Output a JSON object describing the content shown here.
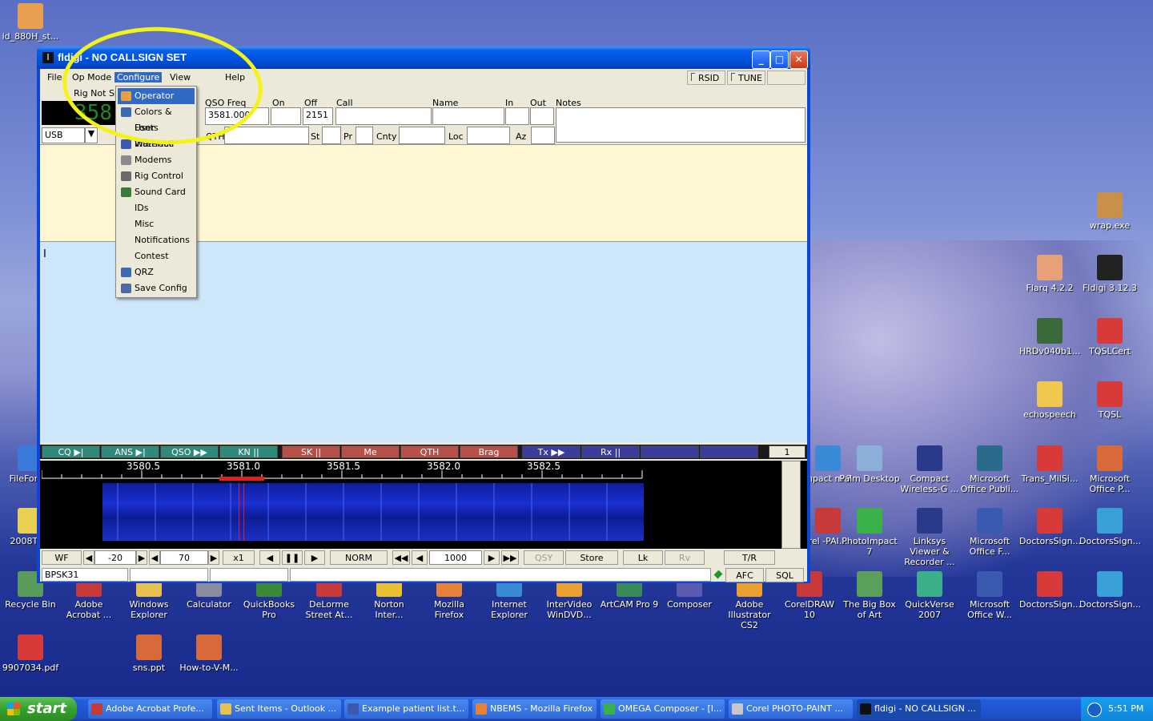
{
  "window": {
    "title": "fldigi - NO CALLSIGN SET"
  },
  "menubar": {
    "items": [
      "File",
      "Op Mode",
      "Configure",
      "View",
      "Help"
    ],
    "rsid": "RSID",
    "tune": "TUNE"
  },
  "rig": {
    "status": "Rig Not Sp",
    "freq_display": "358",
    "mode": "USB"
  },
  "qso": {
    "freq_label": "QSO Freq",
    "freq_value": "3581.000",
    "on_label": "On",
    "on_value": "",
    "off_label": "Off",
    "off_value": "2151",
    "call_label": "Call",
    "name_label": "Name",
    "in_label": "In",
    "out_label": "Out",
    "notes_label": "Notes",
    "qth_label": "QTH",
    "st_label": "St",
    "pr_label": "Pr",
    "cnty_label": "Cnty",
    "loc_label": "Loc",
    "az_label": "Az"
  },
  "configure_menu": {
    "items": [
      "Operator",
      "Colors & Fonts",
      "User Interface",
      "Waterfall",
      "Modems",
      "Rig Control",
      "Sound Card",
      "IDs",
      "Misc",
      "Notifications",
      "Contest",
      "QRZ",
      "Save Config"
    ],
    "selected": "Operator"
  },
  "macros": {
    "items": [
      {
        "label": "CQ ▶|",
        "color": "#2f8a7a"
      },
      {
        "label": "ANS ▶|",
        "color": "#2f8a7a"
      },
      {
        "label": "QSO ▶▶",
        "color": "#2f8a7a"
      },
      {
        "label": "KN ||",
        "color": "#2f8a7a"
      },
      {
        "label": "SK ||",
        "color": "#b8504a"
      },
      {
        "label": "Me",
        "color": "#b8504a"
      },
      {
        "label": "QTH",
        "color": "#b8504a"
      },
      {
        "label": "Brag",
        "color": "#b8504a"
      },
      {
        "label": "Tx ▶▶",
        "color": "#3c3c9a"
      },
      {
        "label": "Rx ||",
        "color": "#3c3c9a"
      },
      {
        "label": "",
        "color": "#3c3c9a"
      },
      {
        "label": "",
        "color": "#3c3c9a"
      }
    ],
    "page": "1"
  },
  "waterfall": {
    "ticks": [
      "3580.5",
      "3581.0",
      "3581.5",
      "3582.0",
      "3582.5"
    ]
  },
  "controls": {
    "wf": "WF",
    "min_db": "-20",
    "range_db": "70",
    "zoom": "x1",
    "norm": "NORM",
    "cursor": "1000",
    "qsy": "QSY",
    "store": "Store",
    "lk": "Lk",
    "rv": "Rv",
    "tr": "T/R"
  },
  "status": {
    "mode": "BPSK31",
    "afc": "AFC",
    "sql": "SQL"
  },
  "desktop_icons": [
    {
      "label": "id_880H_st...",
      "color": "#e8a050"
    },
    {
      "label": "wrap.exe",
      "color": "#c8904a"
    },
    {
      "label": "Flarq 4.2.2",
      "color": "#e8a078"
    },
    {
      "label": "Fldigi 3.12.3",
      "color": "#222222"
    },
    {
      "label": "HRDv040b1...",
      "color": "#3a6a3a"
    },
    {
      "label": "TQSLCert",
      "color": "#d83a3a"
    },
    {
      "label": "echospeech",
      "color": "#f0c850"
    },
    {
      "label": "TQSL",
      "color": "#d83a3a"
    },
    {
      "label": "FileForma",
      "color": "#3a7ad8"
    },
    {
      "label": "mpact m 7",
      "color": "#3a8ad8"
    },
    {
      "label": "Palm Desktop",
      "color": "#8ab0d8"
    },
    {
      "label": "Compact Wireless-G ...",
      "color": "#2a3a8a"
    },
    {
      "label": "Microsoft Office Publi...",
      "color": "#2a6a8a"
    },
    {
      "label": "Trans_MilSi...",
      "color": "#d83a3a"
    },
    {
      "label": "Microsoft Office P...",
      "color": "#d86a3a"
    },
    {
      "label": "2008Tour",
      "color": "#e8d050"
    },
    {
      "label": "rel -PAI...",
      "color": "#c83a3a"
    },
    {
      "label": "PhotoImpact 7",
      "color": "#3ab04a"
    },
    {
      "label": "Linksys Viewer & Recorder ...",
      "color": "#2a3a8a"
    },
    {
      "label": "Microsoft Office F...",
      "color": "#3a5ab0"
    },
    {
      "label": "DoctorsSign...",
      "color": "#d83a3a"
    },
    {
      "label": "DoctorsSign...",
      "color": "#3aa0d8"
    },
    {
      "label": "Recycle Bin",
      "color": "#5a9a5a"
    },
    {
      "label": "Adobe Acrobat ...",
      "color": "#c83a3a"
    },
    {
      "label": "Windows Explorer",
      "color": "#e8c050"
    },
    {
      "label": "Calculator",
      "color": "#8a8aa0"
    },
    {
      "label": "QuickBooks Pro",
      "color": "#3a8a3a"
    },
    {
      "label": "DeLorme Street At...",
      "color": "#c83a3a"
    },
    {
      "label": "Norton Inter...",
      "color": "#e8c030"
    },
    {
      "label": "Mozilla Firefox",
      "color": "#e8803a"
    },
    {
      "label": "Internet Explorer",
      "color": "#3a8ad8"
    },
    {
      "label": "InterVideo WinDVD...",
      "color": "#e8a030"
    },
    {
      "label": "ArtCAM Pro 9",
      "color": "#3a8a5a"
    },
    {
      "label": "Composer",
      "color": "#5a5ab0"
    },
    {
      "label": "Adobe Illustrator CS2",
      "color": "#e8a030"
    },
    {
      "label": "CorelDRAW 10",
      "color": "#c83a3a"
    },
    {
      "label": "The Big Box of Art",
      "color": "#5aa05a"
    },
    {
      "label": "QuickVerse 2007",
      "color": "#3ab08a"
    },
    {
      "label": "Microsoft Office W...",
      "color": "#3a5ab0"
    },
    {
      "label": "DoctorsSign...",
      "color": "#d83a3a"
    },
    {
      "label": "DoctorsSign...",
      "color": "#3aa0d8"
    },
    {
      "label": "9907034.pdf",
      "color": "#d83a3a"
    },
    {
      "label": "sns.ppt",
      "color": "#d86a3a"
    },
    {
      "label": "How-to-V-M...",
      "color": "#d86a3a"
    }
  ],
  "taskbar": {
    "start": "start",
    "tasks": [
      {
        "label": "Adobe Acrobat Profe...",
        "color": "#c83a3a"
      },
      {
        "label": "Sent Items - Outlook ...",
        "color": "#e8c050"
      },
      {
        "label": "Example patient list.t...",
        "color": "#3a5ab0"
      },
      {
        "label": "NBEMS - Mozilla Firefox",
        "color": "#e8803a"
      },
      {
        "label": "OMEGA Composer - [I...",
        "color": "#3ab04a"
      },
      {
        "label": "Corel PHOTO-PAINT ...",
        "color": "#c8c8c8"
      },
      {
        "label": "fldigi - NO CALLSIGN ...",
        "color": "#111111"
      }
    ],
    "clock": "5:51 PM"
  }
}
